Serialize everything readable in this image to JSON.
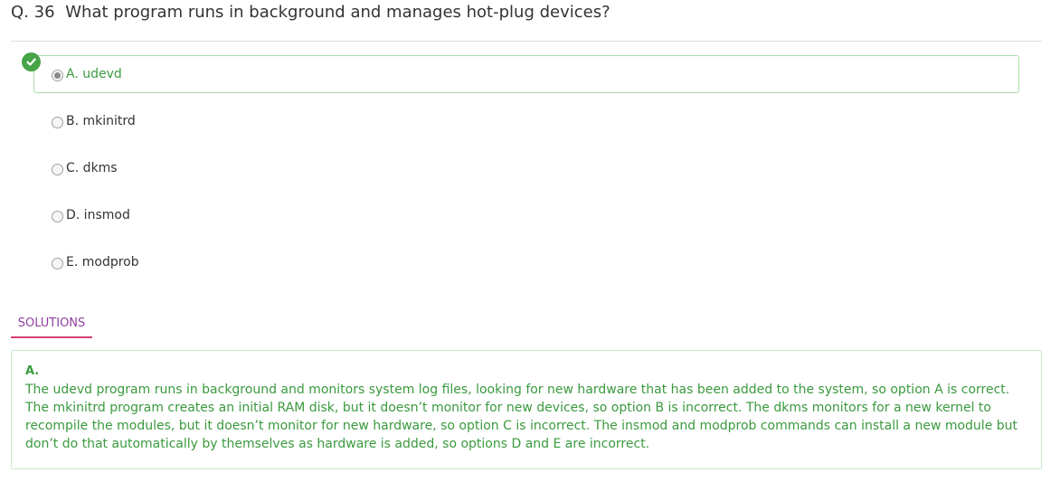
{
  "question": {
    "number": "Q. 36",
    "text": "What program runs in background and manages hot-plug devices?"
  },
  "options": [
    {
      "label": "A. udevd",
      "selected": true,
      "correct": true
    },
    {
      "label": "B. mkinitrd",
      "selected": false,
      "correct": false
    },
    {
      "label": "C. dkms",
      "selected": false,
      "correct": false
    },
    {
      "label": "D. insmod",
      "selected": false,
      "correct": false
    },
    {
      "label": "E. modprob",
      "selected": false,
      "correct": false
    }
  ],
  "solutions_tab": {
    "label": "SOLUTIONS"
  },
  "solution": {
    "answer": "A.",
    "explanation": "The udevd program runs in background and monitors system log files, looking for new hardware that has been added to the system, so option A is correct. The mkinitrd program creates an initial RAM disk, but it doesn’t monitor for new devices, so option B is incorrect. The dkms monitors for a new kernel to recompile the modules, but it doesn’t monitor for new hardware, so option C is incorrect. The insmod and modprob commands can install a new module but don’t do that automatically by themselves as hardware is added, so options D and E are incorrect."
  },
  "icons": {
    "correct": "check-circle-icon"
  },
  "colors": {
    "correct": "#3a9a3e",
    "tab_text": "#8e3fa0",
    "tab_underline": "#d9406f"
  }
}
